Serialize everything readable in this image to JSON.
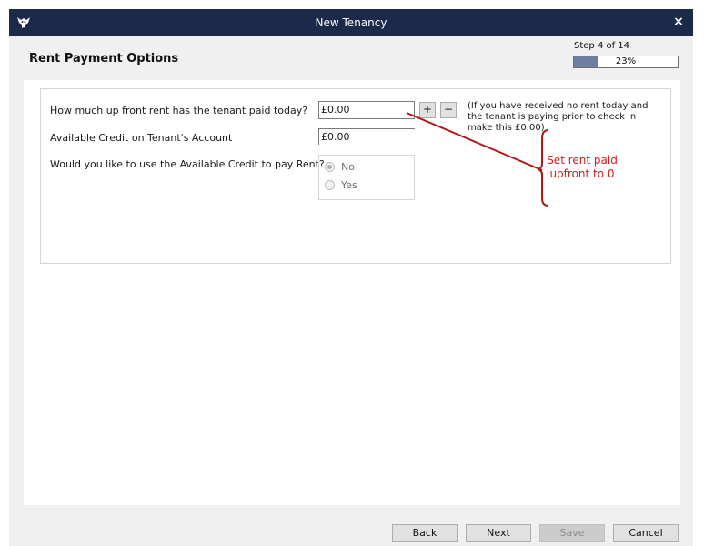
{
  "window": {
    "title": "New Tenancy",
    "close_label": "×"
  },
  "header": {
    "title": "Rent Payment Options",
    "step_label": "Step 4 of 14",
    "progress_text": "23%",
    "progress_value": 0.23
  },
  "form": {
    "upfront_rent_label": "How much up front rent has the tenant paid today?",
    "upfront_rent_value": "£0.00",
    "plus_label": "+",
    "minus_label": "−",
    "hint_text": "(If you have received no rent today and the tenant is paying prior to check in make this £0.00)",
    "available_credit_label": "Available Credit on Tenant's Account",
    "available_credit_value": "£0.00",
    "use_credit_label": "Would you like to use the Available Credit to pay Rent?",
    "options": [
      {
        "label": "No",
        "checked": true
      },
      {
        "label": "Yes",
        "checked": false
      }
    ]
  },
  "annotation": {
    "line1": "Set rent paid",
    "line2": "upfront to 0",
    "color": "#cc1f1f"
  },
  "footer": {
    "back_label": "Back",
    "next_label": "Next",
    "save_label": "Save",
    "cancel_label": "Cancel"
  },
  "colors": {
    "titlebar": "#1b2a4a",
    "progress_fill": "#6f7da3"
  }
}
